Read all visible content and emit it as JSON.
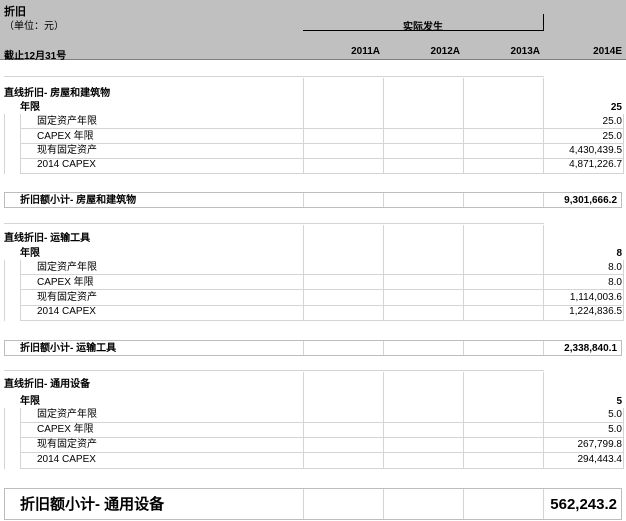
{
  "header": {
    "title": "折旧",
    "unit": "（单位：元）",
    "actual": "实际发生",
    "as_of": "截止12月31号",
    "years": [
      "2011A",
      "2012A",
      "2013A",
      "2014E"
    ]
  },
  "sections": [
    {
      "title": "直线折旧- 房屋和建筑物",
      "years_label": "年限",
      "years_value": "25",
      "items": [
        {
          "label": "固定资产年限",
          "value": "25.0"
        },
        {
          "label": "CAPEX 年限",
          "value": "25.0"
        },
        {
          "label": "现有固定资产",
          "value": "4,430,439.5"
        },
        {
          "label": "2014 CAPEX",
          "value": "4,871,226.7"
        }
      ],
      "subtotal_label": "折旧额小计- 房屋和建筑物",
      "subtotal_value": "9,301,666.2"
    },
    {
      "title": "直线折旧- 运输工具",
      "years_label": "年限",
      "years_value": "8",
      "items": [
        {
          "label": "固定资产年限",
          "value": "8.0"
        },
        {
          "label": "CAPEX 年限",
          "value": "8.0"
        },
        {
          "label": "现有固定资产",
          "value": "1,114,003.6"
        },
        {
          "label": "2014 CAPEX",
          "value": "1,224,836.5"
        }
      ],
      "subtotal_label": "折旧额小计- 运输工具",
      "subtotal_value": "2,338,840.1"
    },
    {
      "title": "直线折旧- 通用设备",
      "years_label": "年限",
      "years_value": "5",
      "items": [
        {
          "label": "固定资产年限",
          "value": "5.0"
        },
        {
          "label": "CAPEX 年限",
          "value": "5.0"
        },
        {
          "label": "现有固定资产",
          "value": "267,799.8"
        },
        {
          "label": "2014 CAPEX",
          "value": "294,443.4"
        }
      ],
      "subtotal_label": "折旧额小计- 通用设备",
      "subtotal_value": "562,243.2"
    }
  ]
}
